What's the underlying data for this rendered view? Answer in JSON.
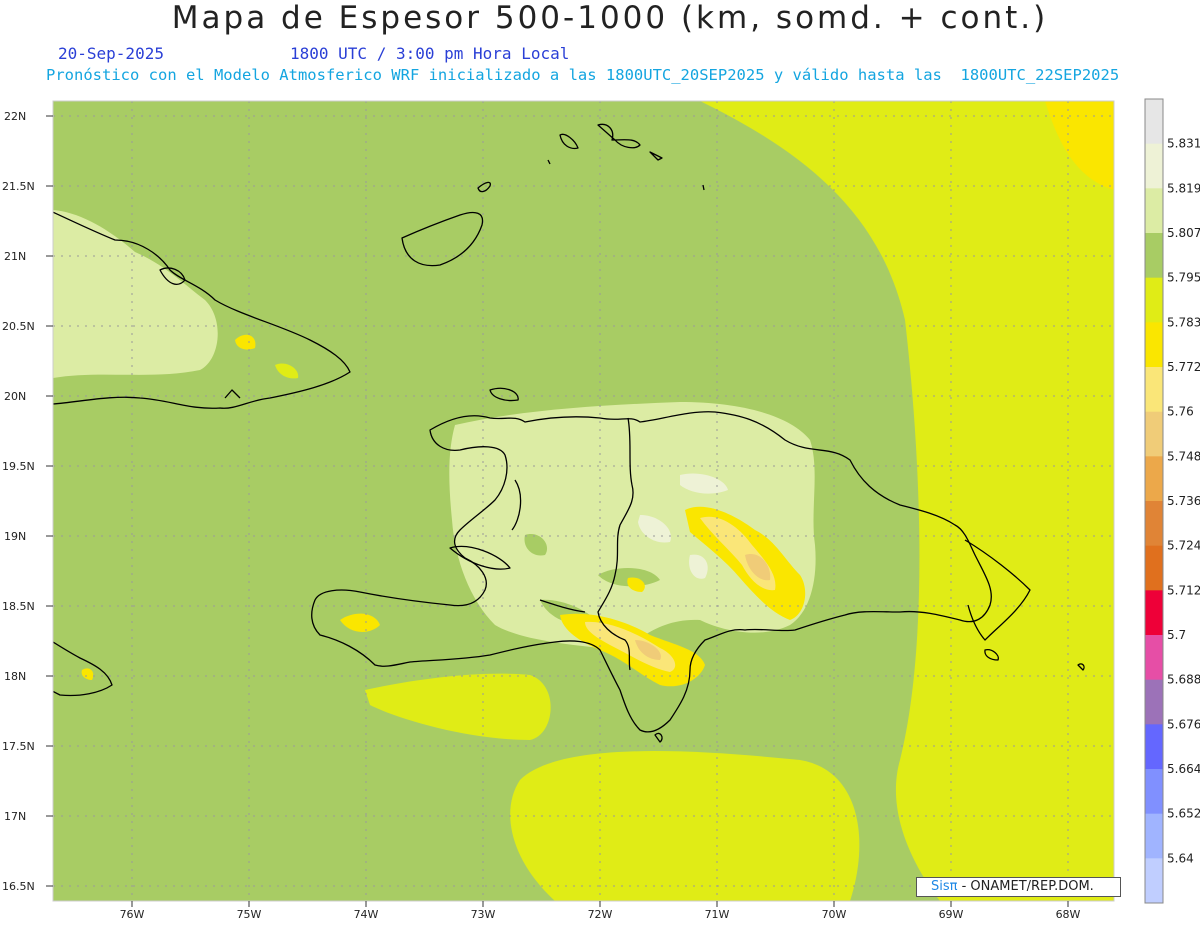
{
  "header": {
    "title": "Mapa de Espesor 500-1000 (km, somd. + cont.)",
    "date": "20-Sep-2025",
    "time": "1800 UTC / 3:00 pm Hora Local",
    "forecast": "Pronóstico con el Modelo Atmosferico WRF inicializado a las 1800UTC_20SEP2025 y válido hasta las  1800UTC_22SEP2025"
  },
  "axes": {
    "lat_labels": [
      "22N",
      "21.5N",
      "21N",
      "20.5N",
      "20N",
      "19.5N",
      "19N",
      "18.5N",
      "18N",
      "17.5N",
      "17N",
      "16.5N"
    ],
    "lon_labels": [
      "76W",
      "75W",
      "74W",
      "73W",
      "72W",
      "71W",
      "70W",
      "69W",
      "68W"
    ]
  },
  "colorbar": {
    "labels": [
      "5.831",
      "5.819",
      "5.807",
      "5.795",
      "5.783",
      "5.772",
      "5.76",
      "5.748",
      "5.736",
      "5.724",
      "5.712",
      "5.7",
      "5.688",
      "5.676",
      "5.664",
      "5.652",
      "5.64"
    ],
    "colors": [
      "#e6e6e6",
      "#eef2d6",
      "#dceca4",
      "#a8cc64",
      "#e0ec16",
      "#fae600",
      "#fae678",
      "#f0cc78",
      "#eca84a",
      "#e08436",
      "#e0701e",
      "#ee0038",
      "#e64ea6",
      "#9c72b8",
      "#6467ff",
      "#8090ff",
      "#a0b4ff",
      "#c0ceff"
    ]
  },
  "credit": {
    "logo": "Sisπ",
    "text": " - ONAMET/REP.DOM."
  },
  "colors": {
    "base_green": "#a8cc64",
    "light_yellow_green": "#dceca4",
    "pale": "#eef2d6",
    "yellow_green": "#e0ec16",
    "yellow": "#fae600",
    "light_orange": "#f0cc78",
    "orange": "#eca84a"
  }
}
